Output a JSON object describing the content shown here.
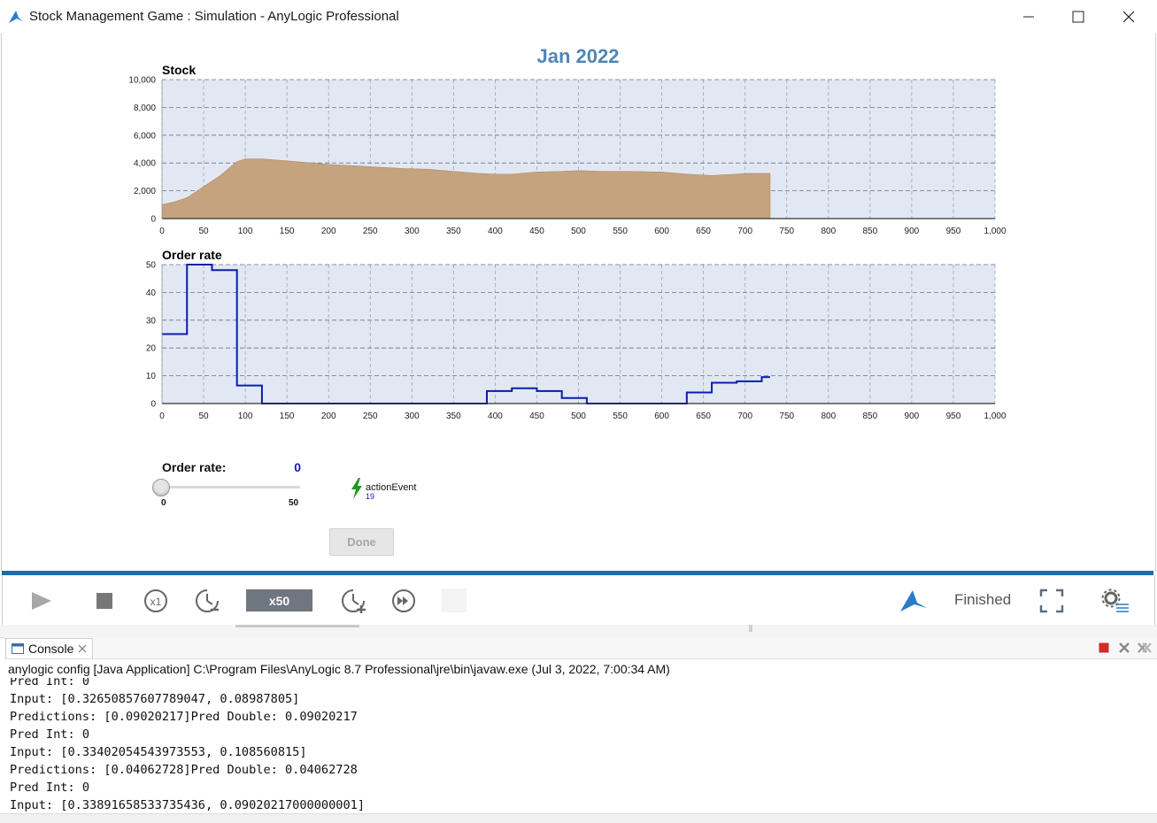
{
  "window": {
    "title": "Stock Management Game : Simulation - AnyLogic Professional"
  },
  "simulation": {
    "date_label": "Jan 2022"
  },
  "colors": {
    "accent": "#1f6ba5",
    "stock_fill": "#c4a37e",
    "order_line": "#0b1ea8",
    "plot_bg": "#e2e8f3",
    "date_label": "#4f86b5"
  },
  "chart_data": [
    {
      "type": "area",
      "title": "Stock",
      "xlabel": "",
      "ylabel": "",
      "xlim": [
        0,
        1000
      ],
      "ylim": [
        0,
        10000
      ],
      "grid": true,
      "x_ticks": [
        "0",
        "50",
        "100",
        "150",
        "200",
        "250",
        "300",
        "350",
        "400",
        "450",
        "500",
        "550",
        "600",
        "650",
        "700",
        "750",
        "800",
        "850",
        "900",
        "950",
        "1,000"
      ],
      "y_ticks": [
        "0",
        "2,000",
        "4,000",
        "6,000",
        "8,000",
        "10,000"
      ],
      "x": [
        0,
        15,
        30,
        50,
        70,
        90,
        100,
        120,
        140,
        170,
        200,
        230,
        260,
        290,
        320,
        350,
        380,
        400,
        420,
        450,
        480,
        500,
        530,
        560,
        600,
        630,
        660,
        690,
        700,
        730
      ],
      "values": [
        1000,
        1200,
        1500,
        2300,
        3100,
        4100,
        4300,
        4300,
        4200,
        4050,
        3900,
        3800,
        3700,
        3600,
        3550,
        3400,
        3250,
        3200,
        3200,
        3350,
        3400,
        3450,
        3400,
        3400,
        3350,
        3200,
        3100,
        3200,
        3250,
        3250
      ]
    },
    {
      "type": "line",
      "title": "Order rate",
      "xlabel": "",
      "ylabel": "",
      "xlim": [
        0,
        1000
      ],
      "ylim": [
        0,
        50
      ],
      "grid": true,
      "step": true,
      "x_ticks": [
        "0",
        "50",
        "100",
        "150",
        "200",
        "250",
        "300",
        "350",
        "400",
        "450",
        "500",
        "550",
        "600",
        "650",
        "700",
        "750",
        "800",
        "850",
        "900",
        "950",
        "1,000"
      ],
      "y_ticks": [
        "0",
        "10",
        "20",
        "30",
        "40",
        "50"
      ],
      "x": [
        0,
        30,
        60,
        90,
        120,
        390,
        420,
        450,
        480,
        510,
        630,
        660,
        690,
        720,
        730
      ],
      "values": [
        25,
        50,
        48,
        6.5,
        0,
        4.5,
        5.5,
        4.5,
        2,
        0,
        4,
        7.5,
        8,
        9.5,
        9.5
      ]
    }
  ],
  "slider": {
    "title": "Order rate:",
    "value": "0",
    "value_fraction": 0,
    "min": "0",
    "max": "50"
  },
  "event": {
    "name": "actionEvent",
    "count": "19"
  },
  "done_button": {
    "label": "Done"
  },
  "controls": {
    "speed": "x50",
    "status": "Finished"
  },
  "console": {
    "tab_label": "Console",
    "header": "anylogic config [Java Application] C:\\Program Files\\AnyLogic 8.7 Professional\\jre\\bin\\javaw.exe  (Jul 3, 2022, 7:00:34 AM)",
    "lines": [
      "Pred Int: 0",
      "Input: [0.32650857607789047, 0.08987805]",
      "Predictions: [0.09020217]Pred Double: 0.09020217",
      "Pred Int: 0",
      "Input: [0.33402054543973553, 0.108560815]",
      "Predictions: [0.04062728]Pred Double: 0.04062728",
      "Pred Int: 0",
      "Input: [0.33891658533735436, 0.09020217000000001]"
    ]
  }
}
